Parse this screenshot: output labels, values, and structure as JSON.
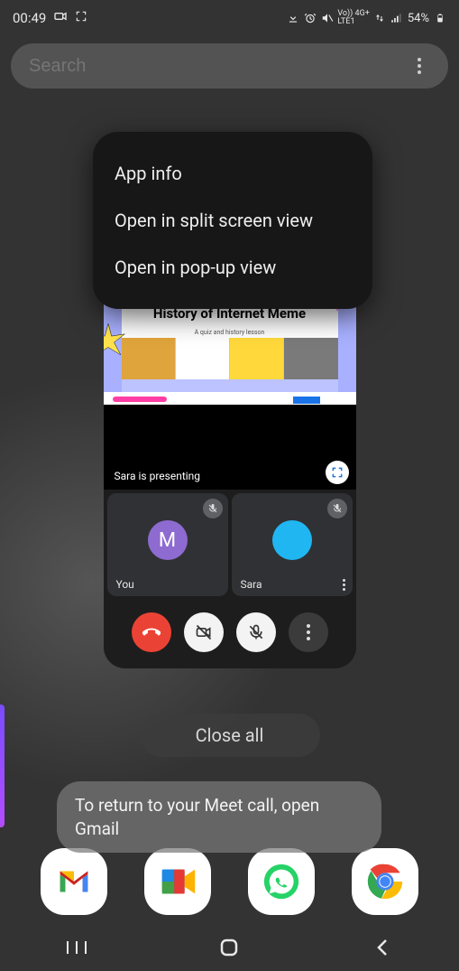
{
  "status_bar": {
    "time": "00:49",
    "battery_text": "54%",
    "net_label_top": "Vo))  4G+",
    "net_label_bot": "LTE1"
  },
  "search": {
    "placeholder": "Search"
  },
  "context_menu": {
    "items": [
      "App info",
      "Open in split screen view",
      "Open in pop-up view"
    ]
  },
  "app_card": {
    "slide_title": "History of Internet Meme",
    "slide_subtitle": "A quiz and history lesson",
    "presenting_label": "Sara is presenting",
    "participants": [
      {
        "initial": "M",
        "name": "You",
        "color": "#8d6bd0"
      },
      {
        "initial": "",
        "name": "Sara",
        "color": "#1fb6f2"
      }
    ]
  },
  "close_all_label": "Close all",
  "toast_text": "To return to your Meet call, open Gmail"
}
